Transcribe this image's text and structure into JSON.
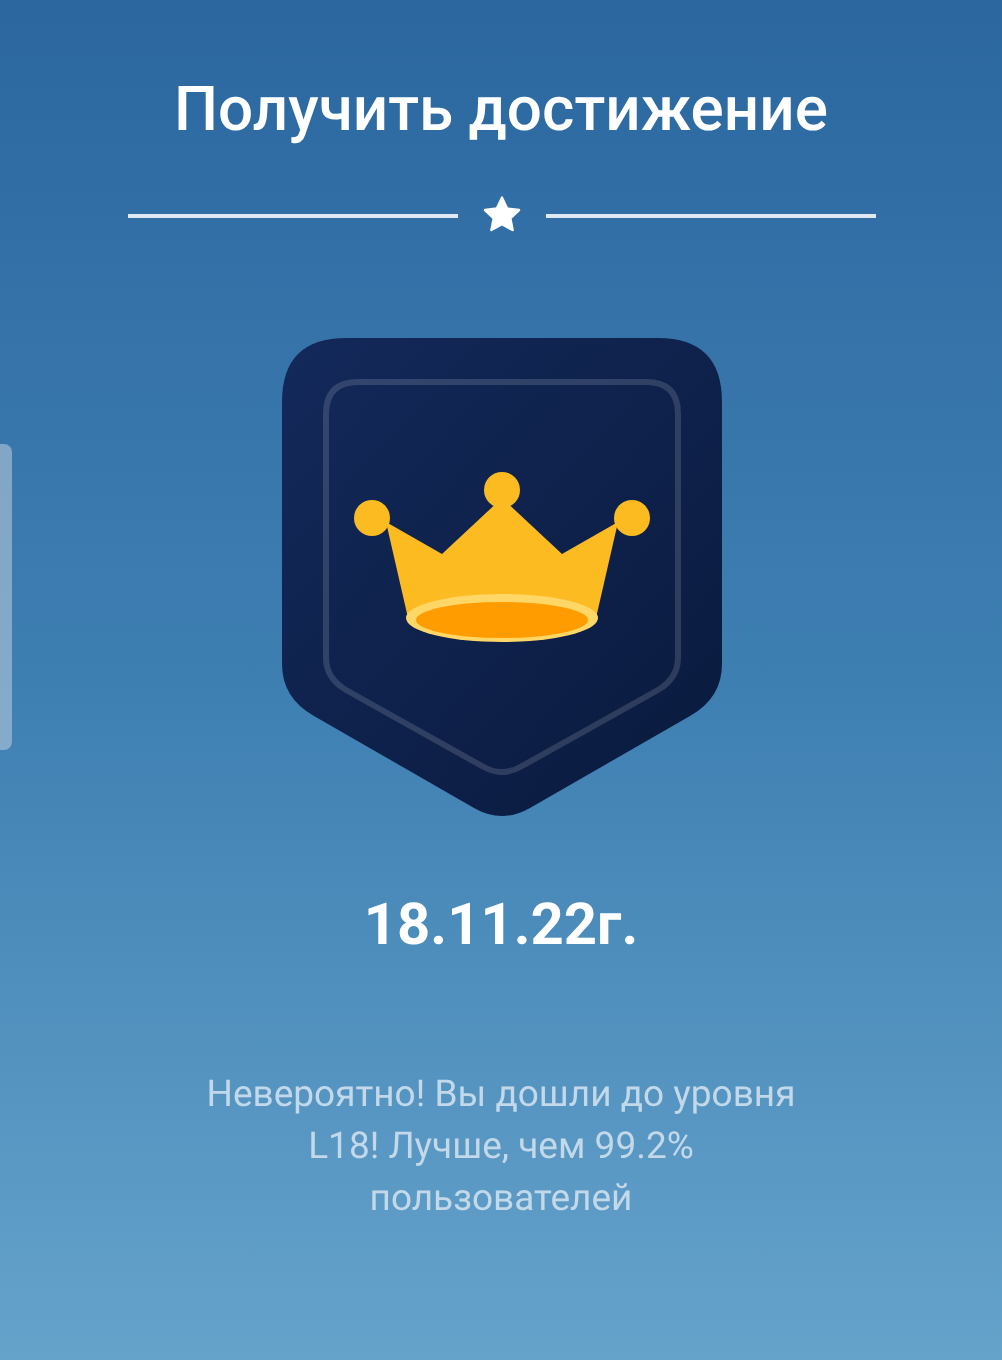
{
  "title": "Получить достижение",
  "date": "18.11.22г.",
  "message": "Невероятно! Вы дошли до уровня L18! Лучше, чем 99.2% пользователей"
}
